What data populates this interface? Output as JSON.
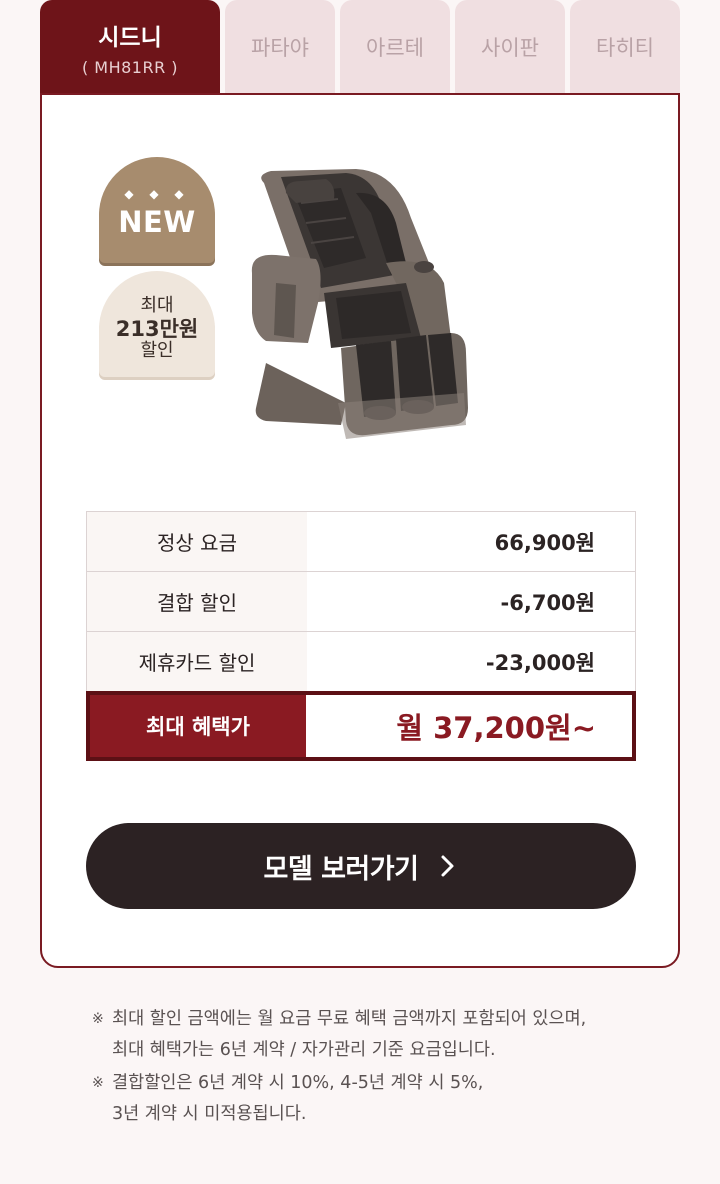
{
  "tabs": [
    {
      "name": "시드니",
      "model": "( MH81RR )",
      "active": true
    },
    {
      "name": "파타야",
      "active": false
    },
    {
      "name": "아르테",
      "active": false
    },
    {
      "name": "사이판",
      "active": false
    },
    {
      "name": "타히티",
      "active": false
    }
  ],
  "badges": {
    "new_dots": "◆ ◆ ◆",
    "new_label": "NEW",
    "discount_line1": "최대",
    "discount_line2": "213만원",
    "discount_line3": "할인"
  },
  "product": {
    "image_icon": "massage-chair-image"
  },
  "pricing": {
    "rows": [
      {
        "label": "정상 요금",
        "value": "66,900원"
      },
      {
        "label": "결합 할인",
        "value": "-6,700원"
      },
      {
        "label": "제휴카드 할인",
        "value": "-23,000원"
      }
    ],
    "highlight": {
      "label": "최대 혜택가",
      "value": "월 37,200원~"
    }
  },
  "cta": {
    "label": "모델 보러가기",
    "icon": "chevron-right-icon"
  },
  "notes": [
    {
      "mark": "※",
      "line1": "최대 할인 금액에는 월 요금 무료 혜택 금액까지 포함되어 있으며,",
      "line2": "최대 혜택가는 6년 계약 / 자가관리 기준 요금입니다."
    },
    {
      "mark": "※",
      "line1": "결합할인은 6년 계약 시 10%, 4-5년 계약 시 5%,",
      "line2": "3년 계약 시 미적용됩니다."
    }
  ],
  "colors": {
    "accent": "#6e1419",
    "highlight_red": "#8a1a22",
    "tab_inactive_bg": "#f0dfe1",
    "cta_bg": "#2c2223",
    "badge_new": "#a78c6e",
    "badge_discount": "#efe6dc"
  }
}
